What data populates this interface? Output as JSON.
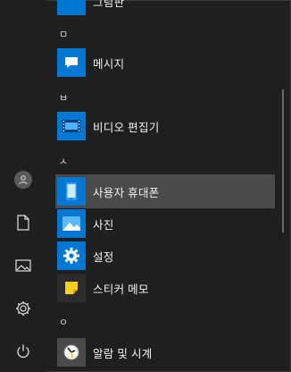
{
  "colors": {
    "bg": "#1f1f1f",
    "tile_blue": "#0078d4",
    "selected_row": "#4a4a4a",
    "sticky_yellow": "#f7d21c"
  },
  "rail": {
    "items": [
      {
        "name": "user-account-button",
        "icon": "person-icon"
      },
      {
        "name": "documents-button",
        "icon": "document-icon"
      },
      {
        "name": "pictures-button",
        "icon": "picture-icon"
      },
      {
        "name": "settings-rail-button",
        "icon": "gear-icon"
      },
      {
        "name": "power-button",
        "icon": "power-icon"
      }
    ]
  },
  "list": {
    "top_partial_label": "그림판",
    "letters": {
      "m": "ㅁ",
      "b": "ㅂ",
      "s": "ㅅ",
      "o": "ㅇ"
    },
    "apps": [
      {
        "label": "메시지",
        "icon": "chat-bubble-icon"
      },
      {
        "label": "비디오 편집기",
        "icon": "film-icon"
      },
      {
        "label": "사용자 휴대폰",
        "icon": "phone-icon",
        "selected": true
      },
      {
        "label": "사진",
        "icon": "photos-icon"
      },
      {
        "label": "설정",
        "icon": "gear-icon"
      },
      {
        "label": "스티커 메모",
        "icon": "sticky-note-icon"
      },
      {
        "label": "알람 및 시계",
        "icon": "clock-icon"
      }
    ]
  }
}
